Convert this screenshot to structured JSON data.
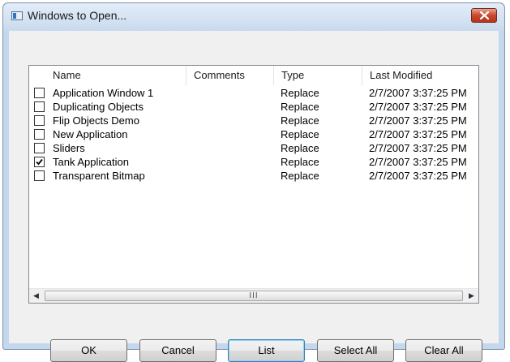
{
  "window": {
    "title": "Windows to Open...",
    "icon": "window-icon",
    "close_icon": "close-x-icon"
  },
  "list": {
    "columns": [
      "Name",
      "Comments",
      "Type",
      "Last Modified"
    ],
    "rows": [
      {
        "name": "Application Window 1",
        "comments": "",
        "type": "Replace",
        "modified": "2/7/2007 3:37:25 PM",
        "checked": false
      },
      {
        "name": "Duplicating Objects",
        "comments": "",
        "type": "Replace",
        "modified": "2/7/2007 3:37:25 PM",
        "checked": false
      },
      {
        "name": "Flip Objects Demo",
        "comments": "",
        "type": "Replace",
        "modified": "2/7/2007 3:37:25 PM",
        "checked": false
      },
      {
        "name": "New Application",
        "comments": "",
        "type": "Replace",
        "modified": "2/7/2007 3:37:25 PM",
        "checked": false
      },
      {
        "name": "Sliders",
        "comments": "",
        "type": "Replace",
        "modified": "2/7/2007 3:37:25 PM",
        "checked": false
      },
      {
        "name": "Tank Application",
        "comments": "",
        "type": "Replace",
        "modified": "2/7/2007 3:37:25 PM",
        "checked": true
      },
      {
        "name": "Transparent Bitmap",
        "comments": "",
        "type": "Replace",
        "modified": "2/7/2007 3:37:25 PM",
        "checked": false
      }
    ],
    "scroll_grip": "III"
  },
  "buttons": {
    "ok": "OK",
    "cancel": "Cancel",
    "list": "List",
    "select_all": "Select All",
    "clear_all": "Clear All"
  }
}
